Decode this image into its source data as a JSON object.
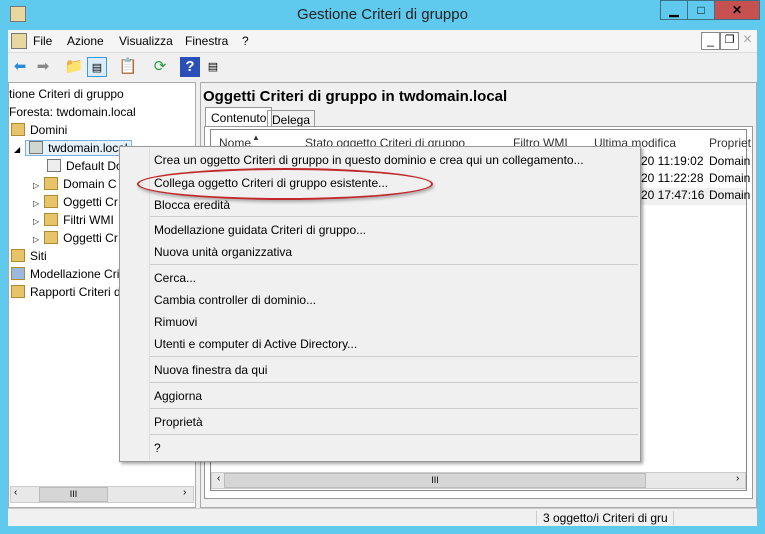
{
  "window": {
    "title": "Gestione Criteri di gruppo",
    "minimize": "▁",
    "maximize": "□",
    "close": "✕"
  },
  "menu": [
    "File",
    "Azione",
    "Visualizza",
    "Finestra",
    "?"
  ],
  "mdi": {
    "minimize": "_",
    "restore": "❐",
    "close": "✕"
  },
  "tree": {
    "root": "tione Criteri di gruppo",
    "forest": "Foresta: twdomain.local",
    "domains": "Domini",
    "domain": "twdomain.local",
    "children": [
      "Default Do",
      "Domain C",
      "Oggetti Cr",
      "Filtri WMI",
      "Oggetti Cr"
    ],
    "sites": "Siti",
    "modeling": "Modellazione Crit",
    "reports": "Rapporti Criteri d"
  },
  "right": {
    "title": "Oggetti Criteri di gruppo in twdomain.local",
    "tabs": [
      "Contenuto",
      "Delega"
    ],
    "columns": [
      "Nome",
      "Stato oggetto Criteri di gruppo",
      "Filtro WMI",
      "Ultima modifica",
      "Propriet"
    ],
    "rows": [
      [
        "20 11:19:02",
        "Domain"
      ],
      [
        "20 11:22:28",
        "Domain"
      ],
      [
        "20 17:47:16",
        "Domain"
      ]
    ]
  },
  "context_menu": [
    "Crea un oggetto Criteri di gruppo in questo dominio e crea qui un collegamento...",
    "Collega oggetto Criteri di gruppo esistente...",
    "Blocca eredità",
    "Modellazione guidata Criteri di gruppo...",
    "Nuova unità organizzativa",
    "Cerca...",
    "Cambia controller di dominio...",
    "Rimuovi",
    "Utenti e computer di Active Directory...",
    "Nuova finestra da qui",
    "Aggiorna",
    "Proprietà",
    "?"
  ],
  "status": "3 oggetto/i Criteri di gru",
  "colors": {
    "frame": "#5fcaed",
    "close": "#c75050",
    "highlight_ring": "#c0282a"
  }
}
